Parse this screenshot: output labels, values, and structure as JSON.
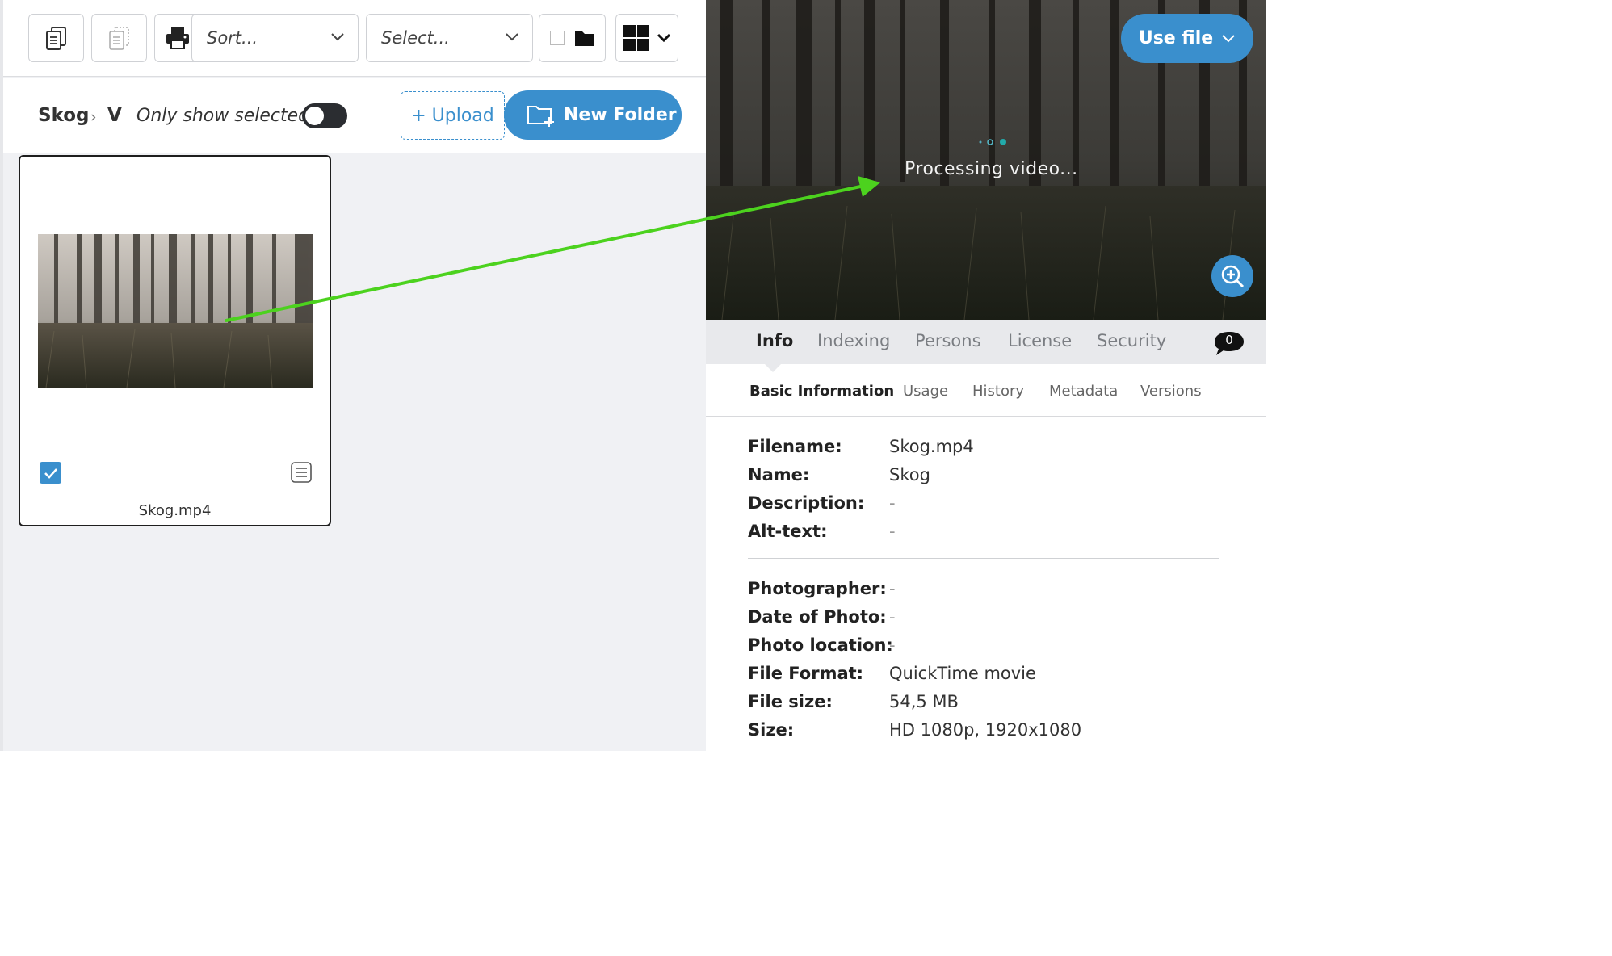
{
  "toolbar": {
    "copy_icon": "copy-document-icon",
    "paste_icon": "paste-document-icon",
    "print_icon": "print-icon",
    "sort_placeholder": "Sort...",
    "select_placeholder": "Select...",
    "folder_icon": "folder-icon",
    "view_icon": "grid-view-icon"
  },
  "breadcrumb": {
    "root": "Skog",
    "current": "V"
  },
  "filter": {
    "only_show_selected_label": "Only show selected",
    "only_show_selected_on": true
  },
  "actions": {
    "upload_label": "+ Upload",
    "new_folder_label": "New Folder"
  },
  "file_card": {
    "name": "Skog.mp4",
    "selected": true
  },
  "preview": {
    "use_file_label": "Use file",
    "status_text": "Processing video..."
  },
  "tabs": [
    {
      "label": "Info",
      "active": true
    },
    {
      "label": "Indexing",
      "active": false
    },
    {
      "label": "Persons",
      "active": false
    },
    {
      "label": "License",
      "active": false
    },
    {
      "label": "Security",
      "active": false
    }
  ],
  "comment_count": "0",
  "subtabs": [
    {
      "label": "Basic Information",
      "active": true
    },
    {
      "label": "Usage",
      "active": false
    },
    {
      "label": "History",
      "active": false
    },
    {
      "label": "Metadata",
      "active": false
    },
    {
      "label": "Versions",
      "active": false
    }
  ],
  "info": {
    "filename": {
      "label": "Filename:",
      "value": "Skog.mp4"
    },
    "name": {
      "label": "Name:",
      "value": "Skog"
    },
    "description": {
      "label": "Description:",
      "value": "-"
    },
    "alt_text": {
      "label": "Alt-text:",
      "value": "-"
    },
    "photographer": {
      "label": "Photographer:",
      "value": "-"
    },
    "date_of_photo": {
      "label": "Date of Photo:",
      "value": "-"
    },
    "photo_location": {
      "label": "Photo location:",
      "value": "-"
    },
    "file_format": {
      "label": "File Format:",
      "value": "QuickTime movie"
    },
    "file_size": {
      "label": "File size:",
      "value": "54,5 MB"
    },
    "size": {
      "label": "Size:",
      "value": "HD 1080p, 1920x1080"
    }
  },
  "colors": {
    "accent": "#3a8fcd",
    "arrow": "#4cd21e"
  }
}
